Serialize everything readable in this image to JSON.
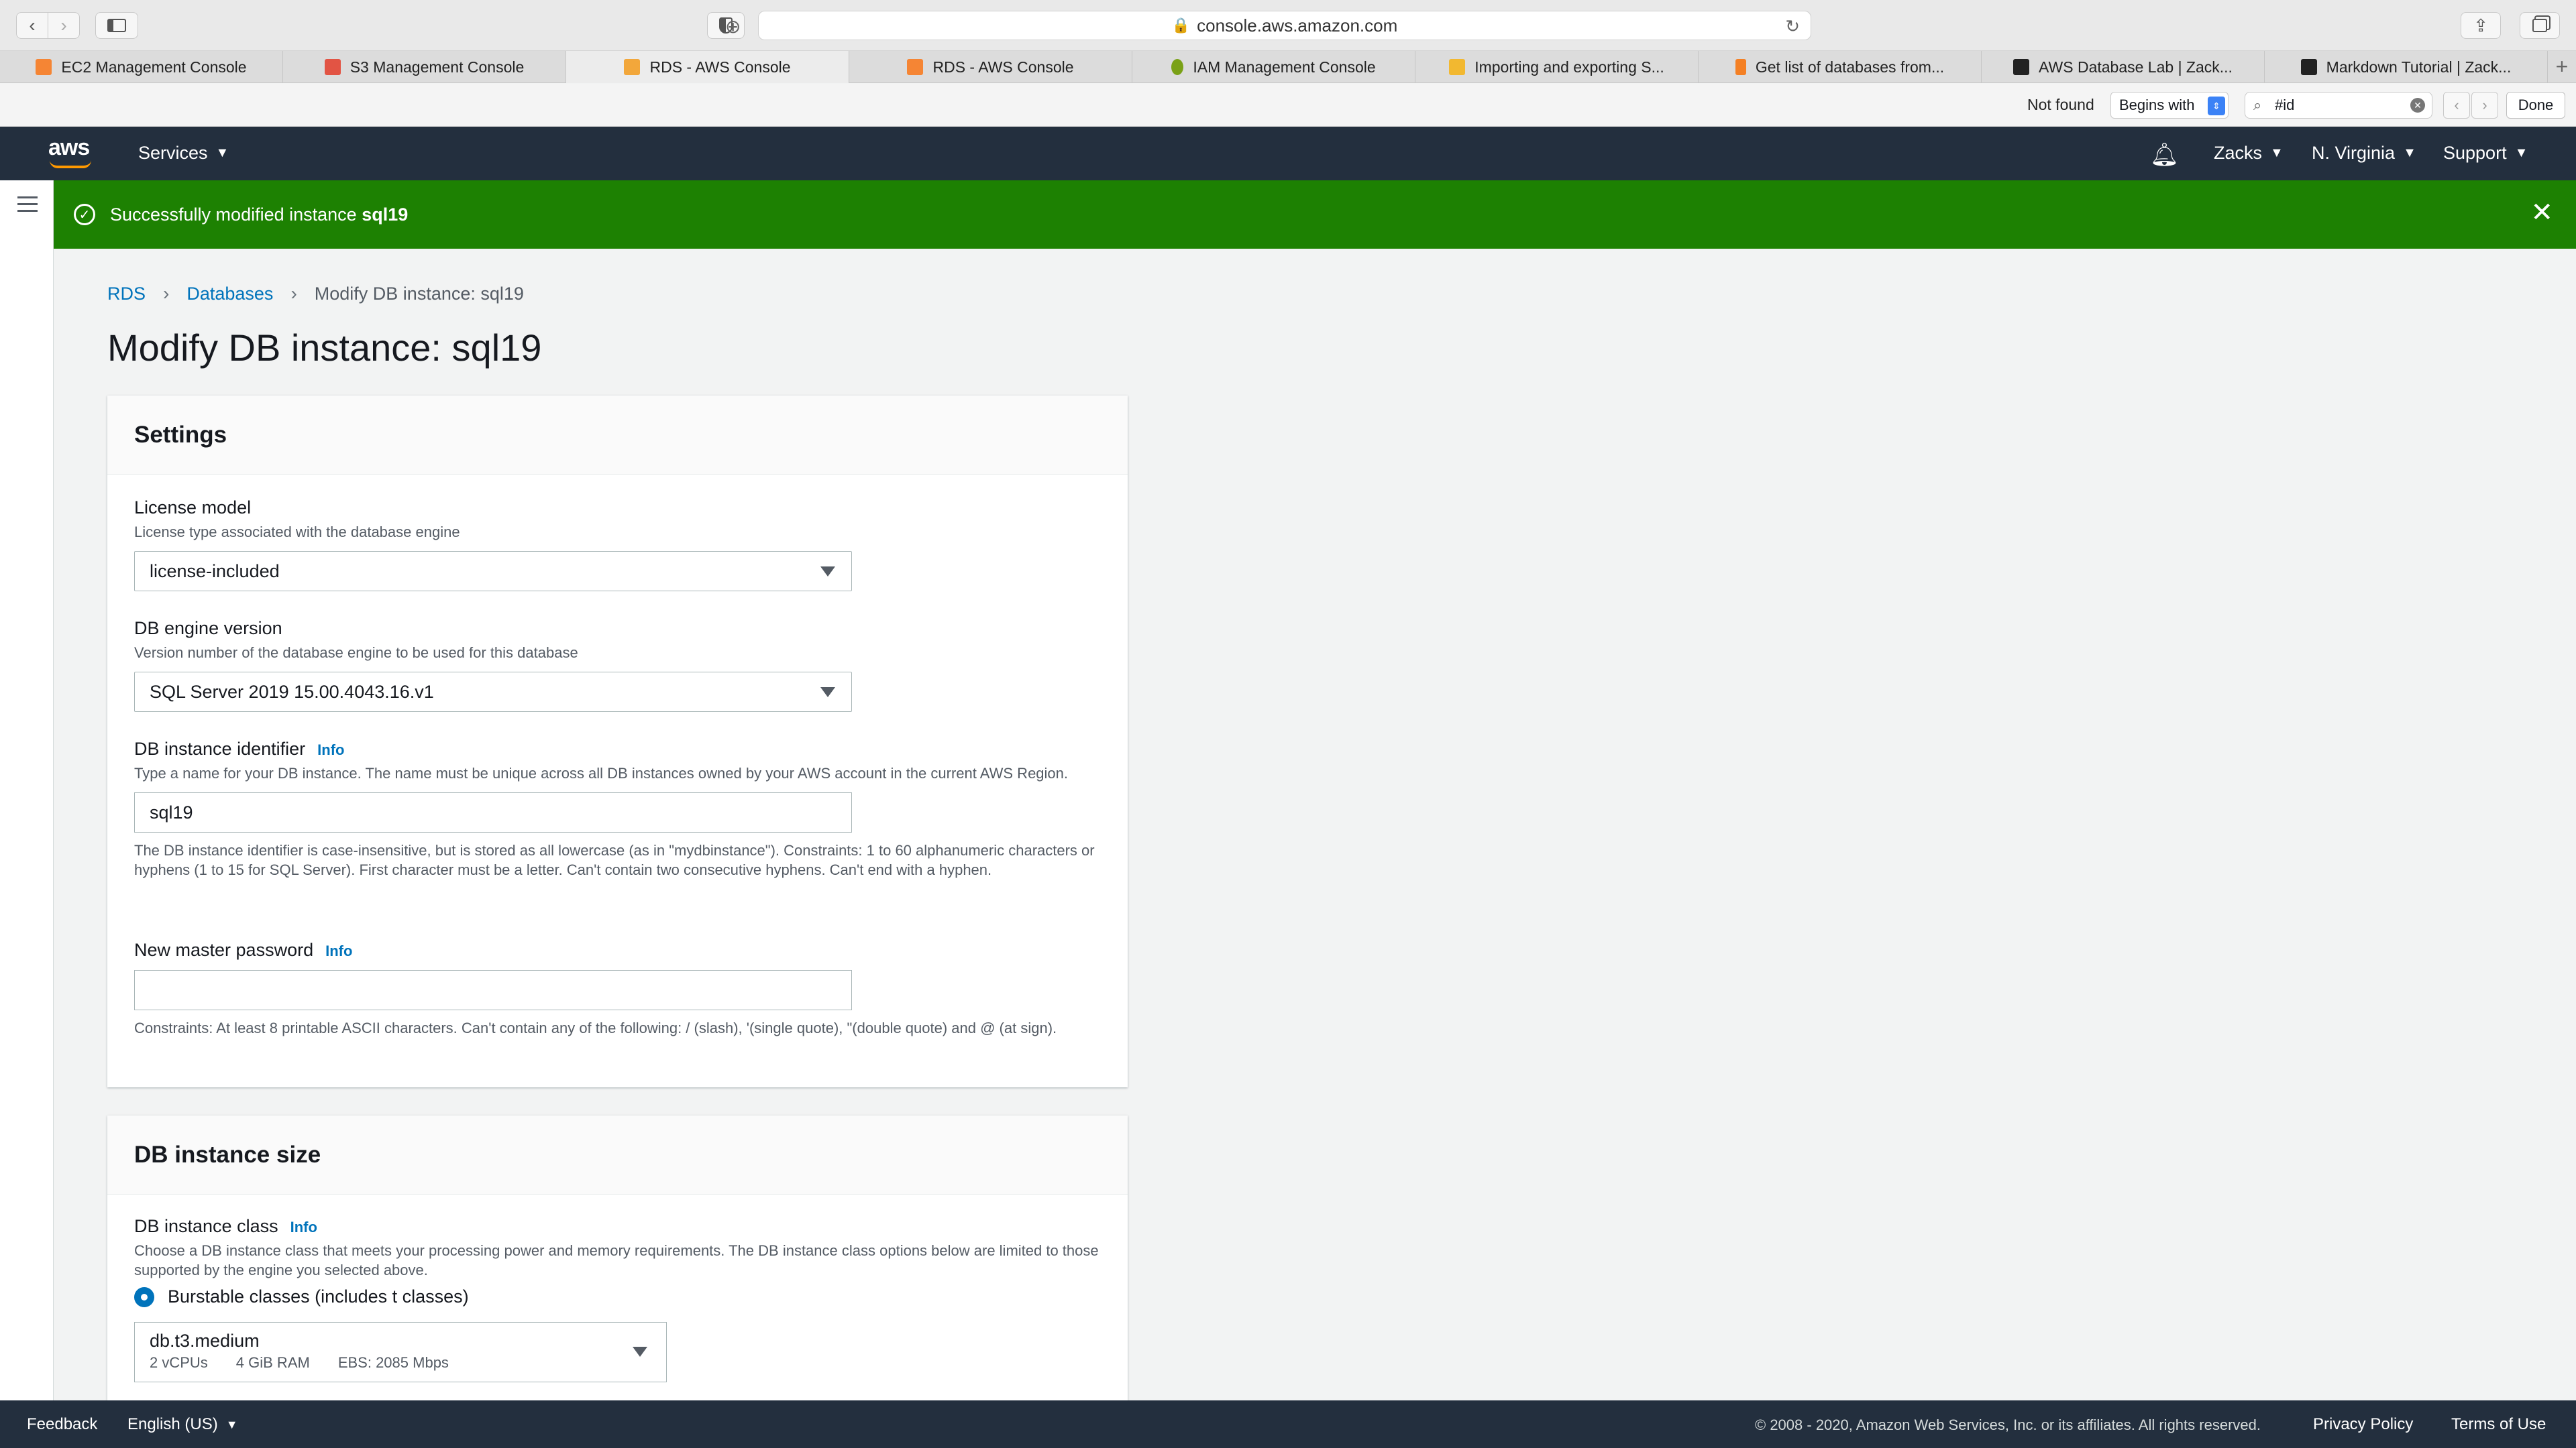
{
  "browser": {
    "url": "console.aws.amazon.com",
    "tabs": [
      {
        "label": "EC2 Management Console",
        "color": "#f58534"
      },
      {
        "label": "S3 Management Console",
        "color": "#e25444"
      },
      {
        "label": "RDS - AWS Console",
        "color": "#f2a73b"
      },
      {
        "label": "RDS - AWS Console",
        "color": "#f58534"
      },
      {
        "label": "IAM Management Console",
        "color": "#7aa116"
      },
      {
        "label": "Importing and exporting S...",
        "color": "#f2b830"
      },
      {
        "label": "Get list of databases from...",
        "color": "#f48024"
      },
      {
        "label": "AWS Database Lab | Zack...",
        "color": "#222222"
      },
      {
        "label": "Markdown Tutorial | Zack...",
        "color": "#222222"
      }
    ],
    "find": {
      "status": "Not found",
      "mode": "Begins with",
      "query": "#id",
      "done_label": "Done"
    }
  },
  "aws": {
    "logo": "aws",
    "services_label": "Services",
    "user": "Zacks",
    "region": "N. Virginia",
    "support": "Support"
  },
  "flash": {
    "message_prefix": "Successfully modified instance ",
    "instance": "sql19"
  },
  "breadcrumb": {
    "rds": "RDS",
    "databases": "Databases",
    "current": "Modify DB instance: sql19"
  },
  "page_title": "Modify DB instance: sql19",
  "settings": {
    "heading": "Settings",
    "license": {
      "label": "License model",
      "desc": "License type associated with the database engine",
      "value": "license-included"
    },
    "engine": {
      "label": "DB engine version",
      "desc": "Version number of the database engine to be used for this database",
      "value": "SQL Server 2019 15.00.4043.16.v1"
    },
    "identifier": {
      "label": "DB instance identifier",
      "info": "Info",
      "desc": "Type a name for your DB instance. The name must be unique across all DB instances owned by your AWS account in the current AWS Region.",
      "value": "sql19",
      "note": "The DB instance identifier is case-insensitive, but is stored as all lowercase (as in \"mydbinstance\"). Constraints: 1 to 60 alphanumeric characters or hyphens (1 to 15 for SQL Server). First character must be a letter. Can't contain two consecutive hyphens. Can't end with a hyphen."
    },
    "password": {
      "label": "New master password",
      "info": "Info",
      "value": "",
      "note": "Constraints: At least 8 printable ASCII characters. Can't contain any of the following: / (slash), '(single quote), \"(double quote) and @ (at sign)."
    }
  },
  "size": {
    "heading": "DB instance size",
    "label": "DB instance class",
    "info": "Info",
    "desc": "Choose a DB instance class that meets your processing power and memory requirements. The DB instance class options below are limited to those supported by the engine you selected above.",
    "radio_label": "Burstable classes (includes t classes)",
    "class_name": "db.t3.medium",
    "vcpu": "2 vCPUs",
    "ram": "4 GiB RAM",
    "ebs": "EBS: 2085 Mbps"
  },
  "footer": {
    "feedback": "Feedback",
    "language": "English (US)",
    "copyright": "© 2008 - 2020, Amazon Web Services, Inc. or its affiliates. All rights reserved.",
    "privacy": "Privacy Policy",
    "terms": "Terms of Use"
  }
}
